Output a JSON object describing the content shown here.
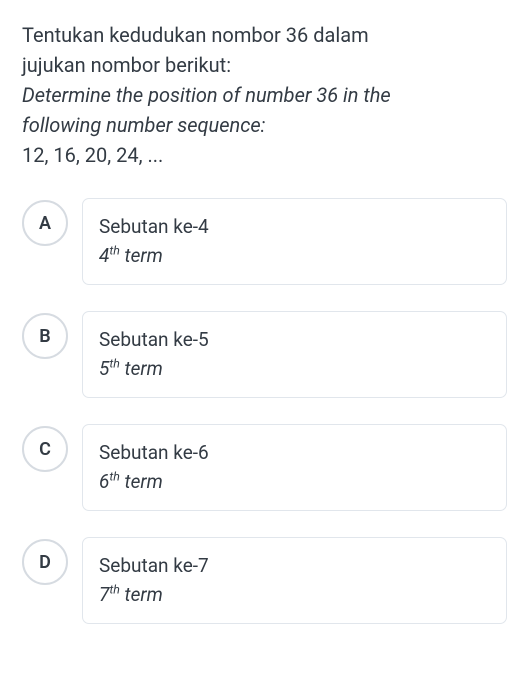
{
  "question": {
    "line1": "Tentukan kedudukan nombor 36 dalam",
    "line2": "jujukan nombor berikut:",
    "italic_line1": "Determine the position of number 36 in the",
    "italic_line2": "following number sequence:",
    "sequence": "12, 16, 20, 24, ..."
  },
  "options": [
    {
      "letter": "A",
      "primary": "Sebutan ke-4",
      "ordinal": "4",
      "suffix": "th",
      "sub_after": " term"
    },
    {
      "letter": "B",
      "primary": "Sebutan ke-5",
      "ordinal": "5",
      "suffix": "th",
      "sub_after": " term"
    },
    {
      "letter": "C",
      "primary": "Sebutan ke-6",
      "ordinal": "6",
      "suffix": "th",
      "sub_after": " term"
    },
    {
      "letter": "D",
      "primary": "Sebutan ke-7",
      "ordinal": "7",
      "suffix": "th",
      "sub_after": " term"
    }
  ]
}
